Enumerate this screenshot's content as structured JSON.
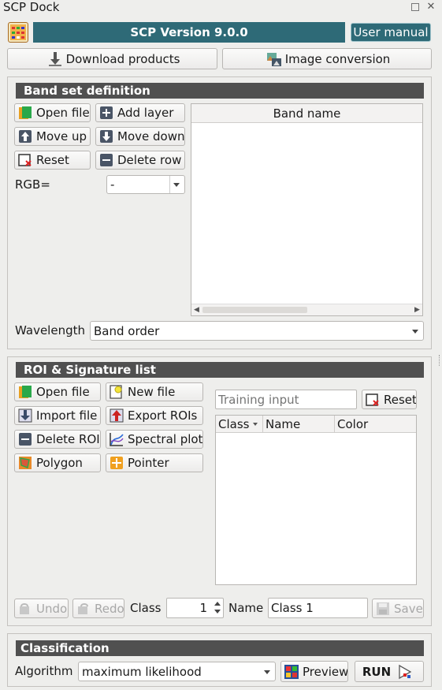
{
  "dock": {
    "title": "SCP Dock"
  },
  "top": {
    "version": "SCP Version 9.0.0",
    "manual": "User manual",
    "download": "Download products",
    "conversion": "Image conversion"
  },
  "band": {
    "header": "Band set definition",
    "open_file": "Open file",
    "add_layer": "Add layer",
    "move_up": "Move up",
    "move_down": "Move down",
    "reset": "Reset",
    "delete_row": "Delete row",
    "rgb_label": "RGB=",
    "rgb_value": "-",
    "table_header": "Band name",
    "wavelength_label": "Wavelength",
    "wavelength_value": "Band order"
  },
  "roi": {
    "header": "ROI & Signature list",
    "open_file": "Open file",
    "new_file": "New file",
    "import_file": "Import file",
    "export_rois": "Export ROIs",
    "delete_roi": "Delete ROI",
    "spectral_plot": "Spectral plot",
    "polygon": "Polygon",
    "pointer": "Pointer",
    "training_placeholder": "Training input",
    "reset": "Reset",
    "col_class": "Class",
    "col_name": "Name",
    "col_color": "Color",
    "undo": "Undo",
    "redo": "Redo",
    "class_label": "Class",
    "class_value": "1",
    "name_label": "Name",
    "name_value": "Class 1",
    "save": "Save"
  },
  "classification": {
    "header": "Classification",
    "algorithm_label": "Algorithm",
    "algorithm_value": "maximum likelihood",
    "preview": "Preview",
    "run": "RUN"
  }
}
